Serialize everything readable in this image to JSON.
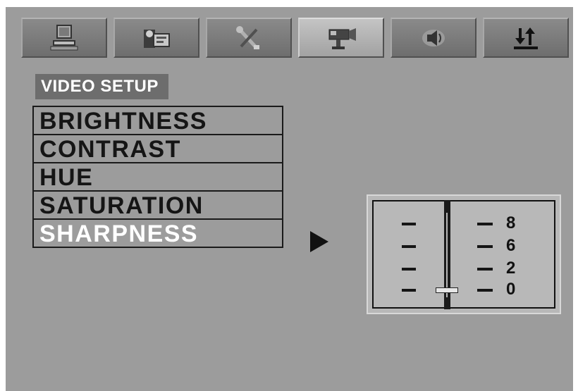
{
  "tabs": [
    {
      "icon": "computer-icon",
      "active": false
    },
    {
      "icon": "language-icon",
      "active": false
    },
    {
      "icon": "tools-icon",
      "active": false
    },
    {
      "icon": "video-camera-icon",
      "active": true
    },
    {
      "icon": "speaker-icon",
      "active": false
    },
    {
      "icon": "sort-arrows-icon",
      "active": false
    }
  ],
  "page": {
    "title": "VIDEO SETUP"
  },
  "menu": {
    "items": [
      {
        "label": "BRIGHTNESS"
      },
      {
        "label": "CONTRAST"
      },
      {
        "label": "HUE"
      },
      {
        "label": "SATURATION"
      },
      {
        "label": "SHARPNESS"
      }
    ],
    "selected_index": 4
  },
  "slider": {
    "levels": [
      "8",
      "6",
      "2",
      "0"
    ],
    "current_value": "0"
  },
  "colors": {
    "screen_bg": "#9c9c9c",
    "title_bg": "#6d6d6d",
    "selected_text": "#ffffff"
  }
}
